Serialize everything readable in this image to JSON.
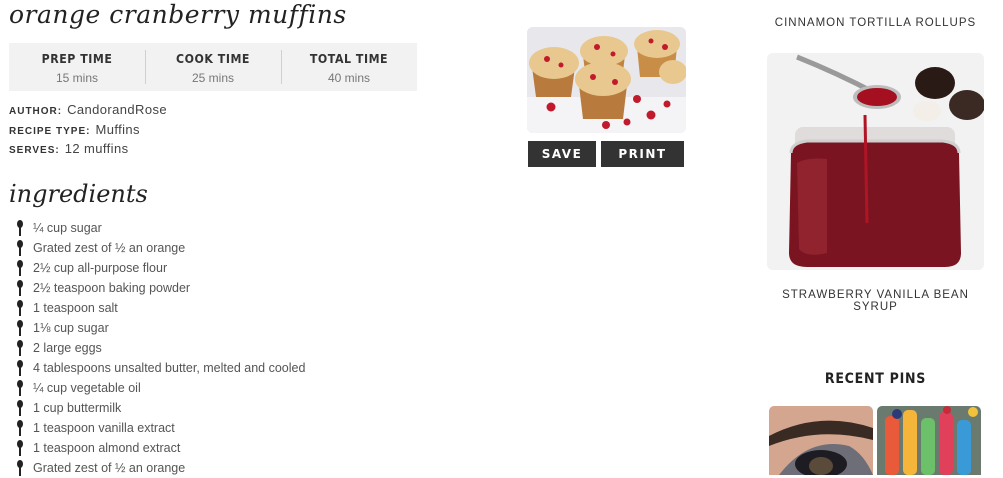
{
  "recipe": {
    "title": "orange cranberry muffins",
    "times": [
      {
        "label": "PREP TIME",
        "value": "15 mins"
      },
      {
        "label": "COOK TIME",
        "value": "25 mins"
      },
      {
        "label": "TOTAL TIME",
        "value": "40 mins"
      }
    ],
    "meta": {
      "author_label": "AUTHOR:",
      "author": "CandorandRose",
      "type_label": "RECIPE TYPE:",
      "type": "Muffins",
      "serves_label": "SERVES:",
      "serves": "12 muffins"
    },
    "buttons": {
      "save": "SAVE",
      "print": "PRINT"
    },
    "ingredients_heading": "ingredients",
    "ingredients": [
      "¼ cup sugar",
      "Grated zest of ½ an orange",
      "2½ cup all-purpose flour",
      "2½ teaspoon baking powder",
      "1 teaspoon salt",
      "1⅛ cup sugar",
      "2 large eggs",
      "4 tablespoons unsalted butter, melted and cooled",
      "¼ cup vegetable oil",
      "1 cup buttermilk",
      "1 teaspoon vanilla extract",
      "1 teaspoon almond extract",
      "Grated zest of ½ an orange"
    ]
  },
  "sidebar": {
    "post1_title": "CINNAMON TORTILLA ROLLUPS",
    "post2_title": "STRAWBERRY VANILLA BEAN SYRUP",
    "recent_pins_heading": "RECENT PINS"
  },
  "icons": {
    "ingredient_bullet": "spoon-icon"
  }
}
